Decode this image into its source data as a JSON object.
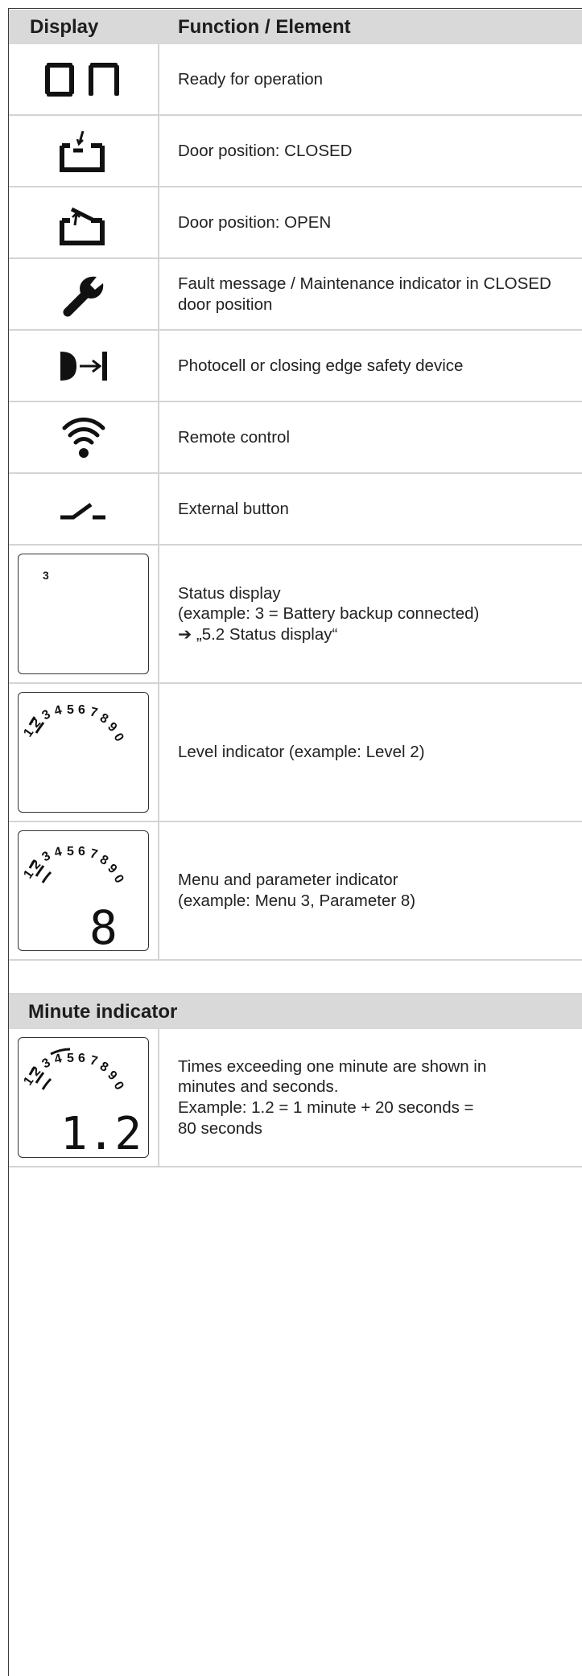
{
  "table": {
    "col_display": "Display",
    "col_function": "Function / Element",
    "rows": [
      {
        "icon": "on-display-icon",
        "lines": [
          "Ready for operation"
        ]
      },
      {
        "icon": "door-closed-icon",
        "lines": [
          "Door position: CLOSED"
        ]
      },
      {
        "icon": "door-open-icon",
        "lines": [
          "Door position: OPEN"
        ]
      },
      {
        "icon": "wrench-icon",
        "lines": [
          "Fault message / Maintenance indicator in CLOSED",
          "door position"
        ]
      },
      {
        "icon": "photocell-icon",
        "lines": [
          "Photocell or closing edge safety device"
        ]
      },
      {
        "icon": "remote-signal-icon",
        "lines": [
          "Remote control"
        ]
      },
      {
        "icon": "external-button-icon",
        "lines": [
          "External button"
        ]
      },
      {
        "icon": "status-lcd-icon",
        "lcd_digit": "3",
        "lines": [
          "Status display",
          "(example: 3 = Battery backup connected)",
          "➔  „5.2 Status display“"
        ]
      },
      {
        "icon": "level-lcd-icon",
        "lcd_scale": [
          "1",
          "2",
          "3",
          "4",
          "5",
          "6",
          "7",
          "8",
          "9",
          "0"
        ],
        "lines": [
          "Level indicator (example: Level 2)"
        ]
      },
      {
        "icon": "menu-lcd-icon",
        "lcd_scale": [
          "1",
          "2",
          "3",
          "4",
          "5",
          "6",
          "7",
          "8",
          "9",
          "0"
        ],
        "lcd_value": "8",
        "lines": [
          "Menu and parameter indicator",
          "(example: Menu 3, Parameter 8)"
        ]
      }
    ]
  },
  "minute_section": {
    "title": "Minute indicator",
    "icon": "minute-lcd-icon",
    "lcd_value": "1.2",
    "lines": [
      "Times exceeding one minute are shown in",
      "minutes and seconds.",
      "Example: 1.2 = 1 minute + 20 seconds =",
      "80 seconds"
    ]
  }
}
